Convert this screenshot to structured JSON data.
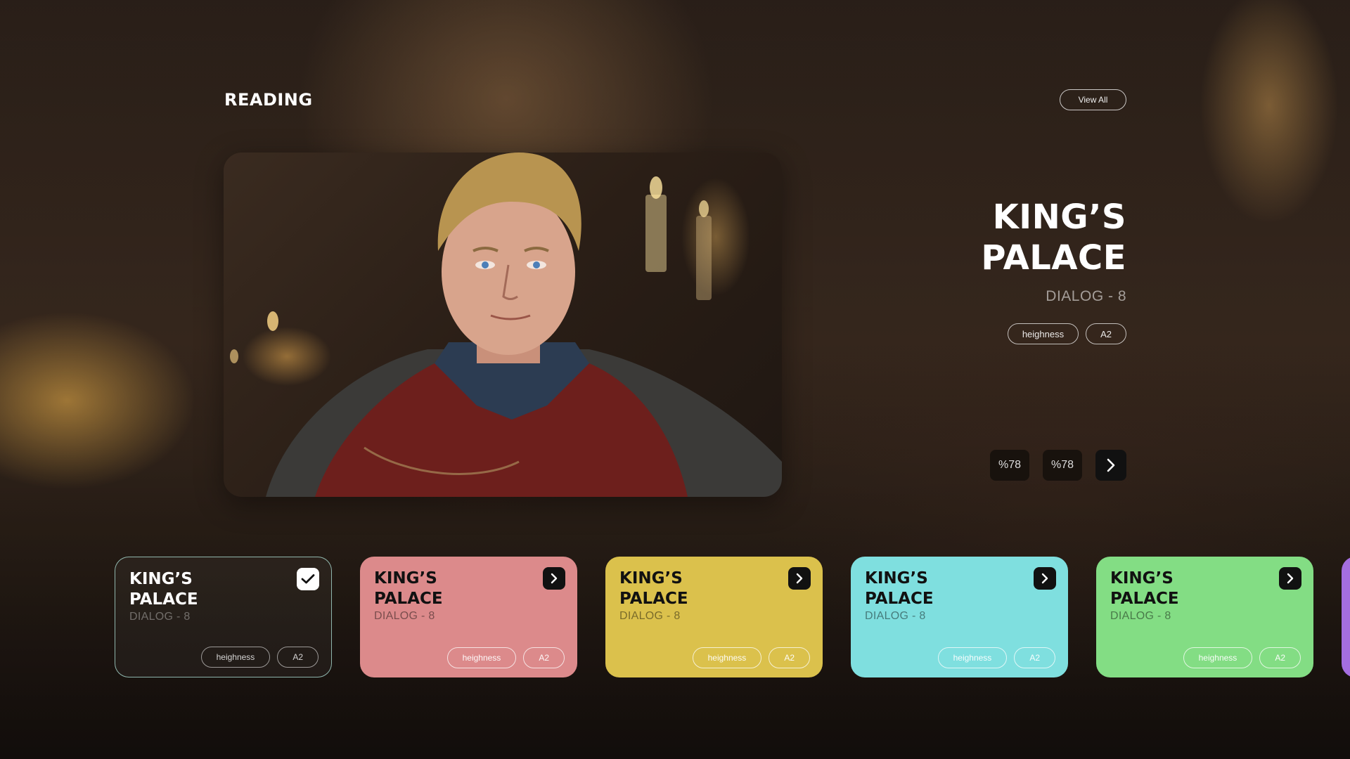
{
  "section": {
    "title": "READING",
    "view_all": "View All"
  },
  "hero": {
    "title_line1": "KING’S",
    "title_line2": "PALACE",
    "subtitle": "DIALOG - 8",
    "tags": [
      "heighness",
      "A2"
    ],
    "stat1": "%78",
    "stat2": "%78"
  },
  "cards": [
    {
      "title_line1": "KING’S",
      "title_line2": "PALACE",
      "subtitle": "DIALOG - 8",
      "tags": [
        "heighness",
        "A2"
      ],
      "state": "selected",
      "color": "transparent",
      "icon": "check-icon"
    },
    {
      "title_line1": "KING’S",
      "title_line2": "PALACE",
      "subtitle": "DIALOG - 8",
      "tags": [
        "heighness",
        "A2"
      ],
      "state": "default",
      "color": "#dc8a8b",
      "icon": "chevron-right-icon"
    },
    {
      "title_line1": "KING’S",
      "title_line2": "PALACE",
      "subtitle": "DIALOG - 8",
      "tags": [
        "heighness",
        "A2"
      ],
      "state": "default",
      "color": "#dbc14c",
      "icon": "chevron-right-icon"
    },
    {
      "title_line1": "KING’S",
      "title_line2": "PALACE",
      "subtitle": "DIALOG - 8",
      "tags": [
        "heighness",
        "A2"
      ],
      "state": "default",
      "color": "#7fdfdf",
      "icon": "chevron-right-icon"
    },
    {
      "title_line1": "KING’S",
      "title_line2": "PALACE",
      "subtitle": "DIALOG - 8",
      "tags": [
        "heighness",
        "A2"
      ],
      "state": "default",
      "color": "#83dd84",
      "icon": "chevron-right-icon"
    },
    {
      "state": "default",
      "color": "#a46ee0"
    }
  ]
}
